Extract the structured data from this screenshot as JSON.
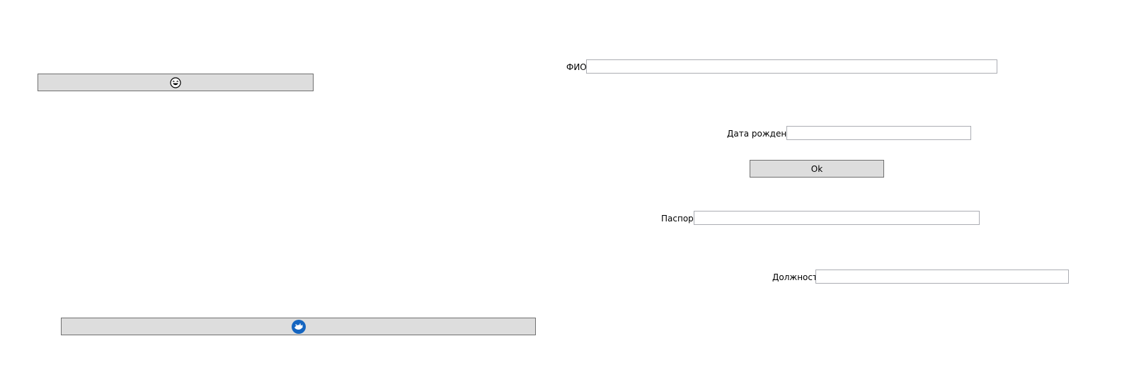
{
  "icons": {
    "top_button_icon": "grinning-face-icon",
    "bottom_button_icon": "blue-logo-icon"
  },
  "colors": {
    "button_bg": "#dddddd",
    "button_border": "#707070",
    "field_border": "#abadb3",
    "logo_blue": "#1565c0"
  },
  "form": {
    "fio_label": "ФИО",
    "birthdate_label": "Дата рождения",
    "ok_label": "Ok",
    "passport_label": "Паспорт",
    "position_label": "Должность"
  }
}
